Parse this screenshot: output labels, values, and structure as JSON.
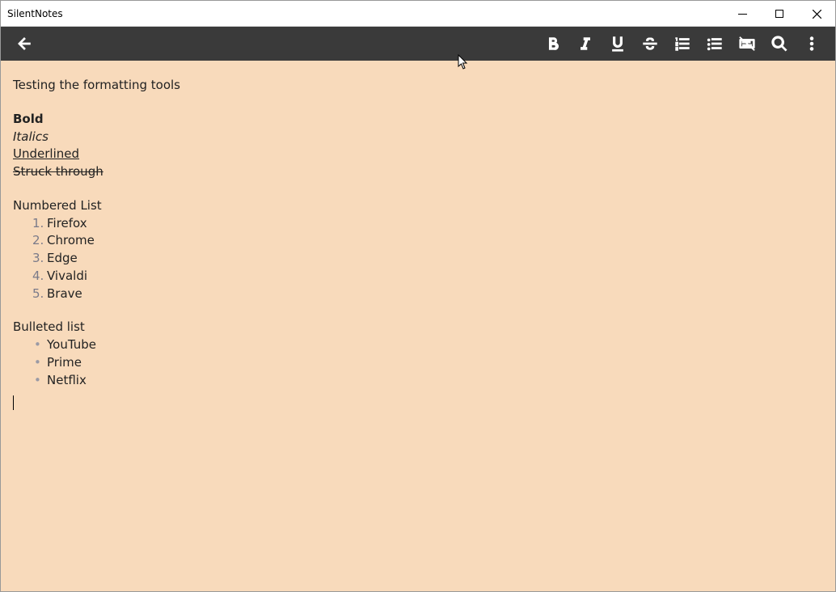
{
  "window": {
    "title": "SilentNotes"
  },
  "note": {
    "heading": "Testing the formatting tools",
    "bold": "Bold",
    "italic": "Italics",
    "underline": "Underlined",
    "strike": "Struck through",
    "numbered_heading": "Numbered List",
    "numbered": [
      "Firefox",
      "Chrome",
      "Edge",
      "Vivaldi",
      "Brave"
    ],
    "bulleted_heading": "Bulleted list",
    "bulleted": [
      "YouTube",
      "Prime",
      "Netflix"
    ]
  }
}
